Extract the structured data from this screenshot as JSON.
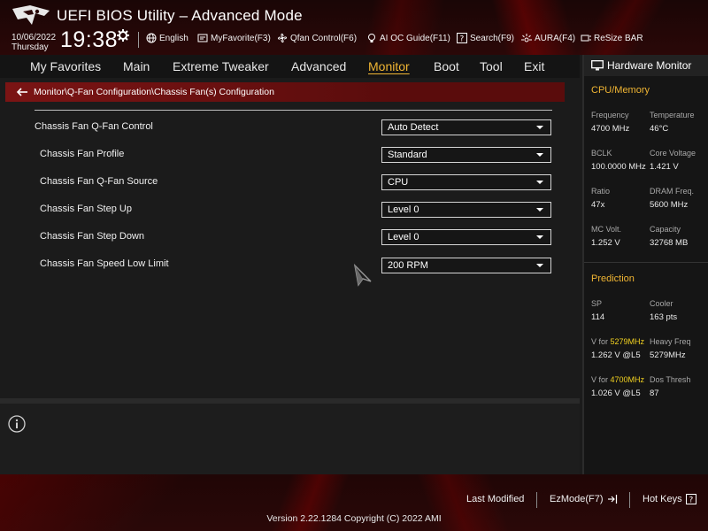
{
  "header": {
    "title": "UEFI BIOS Utility – Advanced Mode",
    "date": "10/06/2022",
    "day": "Thursday",
    "time": "19:38",
    "tools": [
      {
        "label": "English",
        "icon": "globe-icon"
      },
      {
        "label": "MyFavorite(F3)",
        "icon": "favorite-icon"
      },
      {
        "label": "Qfan Control(F6)",
        "icon": "fan-icon"
      },
      {
        "label": "AI OC Guide(F11)",
        "icon": "lightbulb-icon"
      },
      {
        "label": "Search(F9)",
        "icon": "help-search-icon"
      },
      {
        "label": "AURA(F4)",
        "icon": "aura-icon"
      },
      {
        "label": "ReSize BAR",
        "icon": "resize-bar-icon"
      }
    ]
  },
  "nav": {
    "tabs": [
      "My Favorites",
      "Main",
      "Extreme Tweaker",
      "Advanced",
      "Monitor",
      "Boot",
      "Tool",
      "Exit"
    ],
    "active": "Monitor"
  },
  "breadcrumb": "Monitor\\Q-Fan Configuration\\Chassis Fan(s) Configuration",
  "settings": [
    {
      "label": "Chassis Fan Q-Fan Control",
      "value": "Auto Detect"
    },
    {
      "label": "Chassis Fan Profile",
      "value": "Standard"
    },
    {
      "label": "Chassis Fan Q-Fan Source",
      "value": "CPU"
    },
    {
      "label": "Chassis Fan Step Up",
      "value": "Level 0"
    },
    {
      "label": "Chassis Fan Step Down",
      "value": "Level 0"
    },
    {
      "label": "Chassis Fan Speed Low Limit",
      "value": "200 RPM"
    }
  ],
  "hardware_monitor": {
    "title": "Hardware Monitor",
    "cpu_memory": {
      "heading": "CPU/Memory",
      "items": [
        {
          "label": "Frequency",
          "value": "4700 MHz"
        },
        {
          "label": "Temperature",
          "value": "46°C"
        },
        {
          "label": "BCLK",
          "value": "100.0000 MHz"
        },
        {
          "label": "Core Voltage",
          "value": "1.421 V"
        },
        {
          "label": "Ratio",
          "value": "47x"
        },
        {
          "label": "DRAM Freq.",
          "value": "5600 MHz"
        },
        {
          "label": "MC Volt.",
          "value": "1.252 V"
        },
        {
          "label": "Capacity",
          "value": "32768 MB"
        }
      ]
    },
    "prediction": {
      "heading": "Prediction",
      "sp_label": "SP",
      "sp_value": "114",
      "cooler_label": "Cooler",
      "cooler_value": "163 pts",
      "v_for_1_prefix": "V for ",
      "v_for_1_freq": "5279MHz",
      "v_for_1_value": "1.262 V @L5",
      "heavy_freq_label": "Heavy Freq",
      "heavy_freq_value": "5279MHz",
      "v_for_2_prefix": "V for ",
      "v_for_2_freq": "4700MHz",
      "v_for_2_value": "1.026 V @L5",
      "dos_thresh_label": "Dos Thresh",
      "dos_thresh_value": "87"
    }
  },
  "footer": {
    "last_modified": "Last Modified",
    "ezmode": "EzMode(F7)",
    "hot_keys": "Hot Keys",
    "copyright": "Version 2.22.1284 Copyright (C) 2022 AMI"
  },
  "colors": {
    "accent": "#f0b533",
    "breadcrumb_bg": "#7b1414",
    "highlight": "#f0d020"
  }
}
